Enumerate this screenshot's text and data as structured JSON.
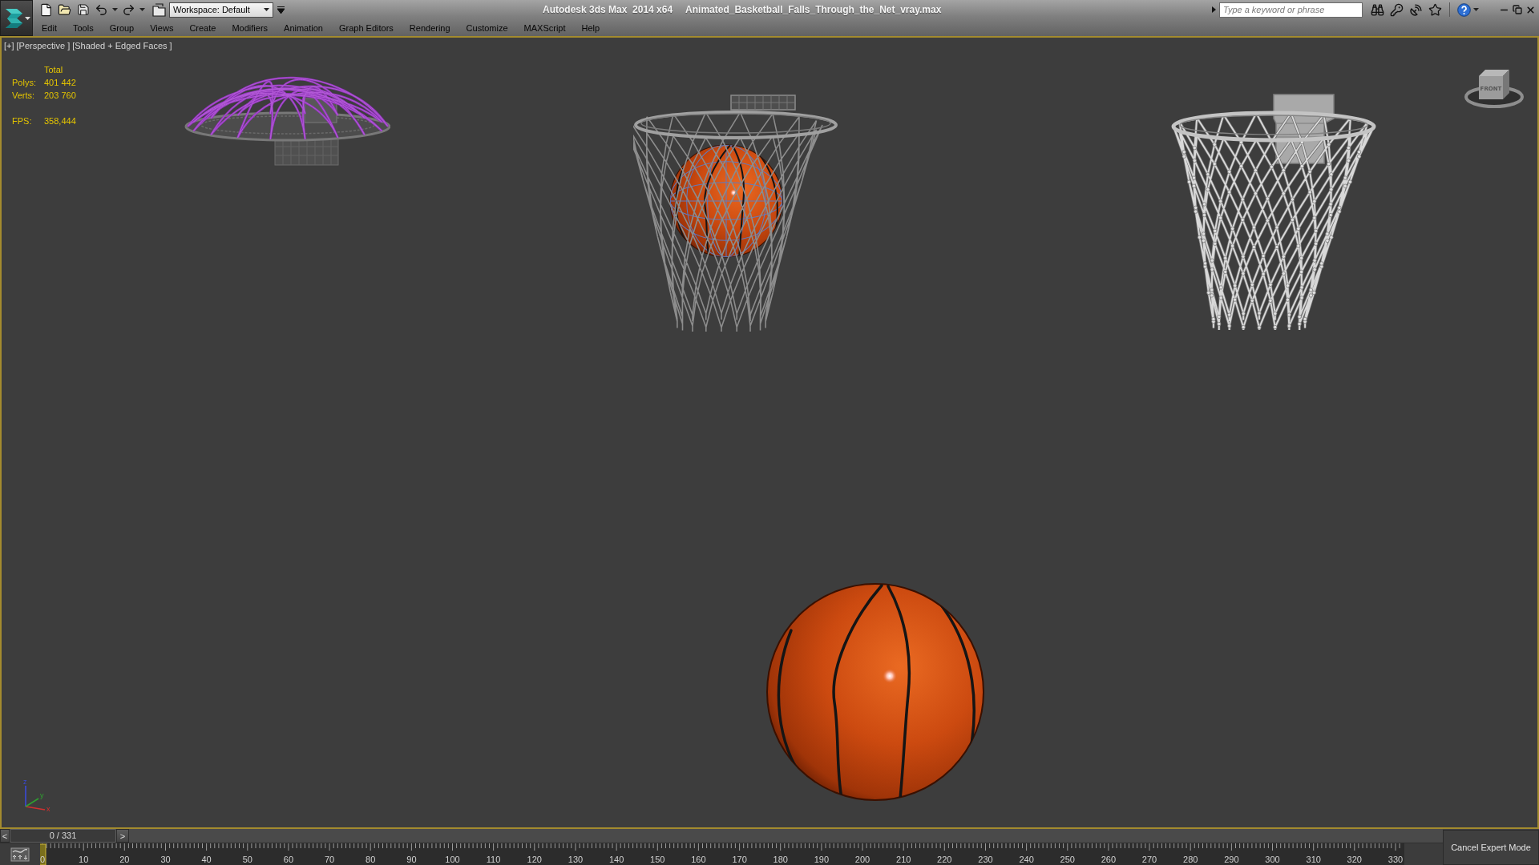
{
  "window": {
    "app_title": "Autodesk 3ds Max  2014 x64",
    "file_title": "Animated_Basketball_Falls_Through_the_Net_vray.max"
  },
  "quick_access": {
    "workspace": "Workspace: Default"
  },
  "search": {
    "placeholder": "Type a keyword or phrase"
  },
  "menu": [
    "Edit",
    "Tools",
    "Group",
    "Views",
    "Create",
    "Modifiers",
    "Animation",
    "Graph Editors",
    "Rendering",
    "Customize",
    "MAXScript",
    "Help"
  ],
  "viewport": {
    "active": true,
    "labels": [
      "[+]",
      "[Perspective ]",
      "[Shaded + Edged Faces ]"
    ],
    "stats": {
      "header": "Total",
      "counts": [
        {
          "label": "Polys:",
          "value": "401 442"
        },
        {
          "label": "Verts:",
          "value": "203 760"
        }
      ],
      "fps": {
        "label": "FPS:",
        "value": "358,444"
      }
    },
    "view_cube": {
      "face_label": "FRONT"
    },
    "axis_labels": [
      "x",
      "y",
      "z"
    ]
  },
  "time_slider": {
    "prev": "<",
    "reading": "0 / 331",
    "next": ">",
    "level": 0
  },
  "track_bar": {
    "frame_labels": [
      "0",
      "10",
      "20",
      "30",
      "40",
      "50",
      "60",
      "70",
      "80",
      "90",
      "100",
      "110",
      "120",
      "130",
      "140",
      "150",
      "160",
      "170",
      "180",
      "190",
      "200",
      "210",
      "220",
      "230",
      "240",
      "250",
      "260",
      "270",
      "280",
      "290",
      "300",
      "310",
      "320",
      "330"
    ]
  },
  "expert_mode_button": "Cancel Expert Mode"
}
